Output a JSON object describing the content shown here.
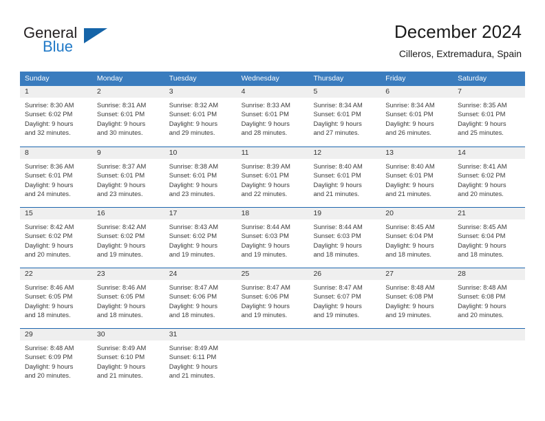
{
  "logo": {
    "word_top": "General",
    "word_bottom": "Blue",
    "triangle_color": "#1564a8",
    "blue_color": "#2079c7"
  },
  "header": {
    "title": "December 2024",
    "subtitle": "Cilleros, Extremadura, Spain"
  },
  "calendar": {
    "header_bg": "#3a7cbe",
    "row_border_color": "#1b64ad",
    "day_strip_bg": "#efefef",
    "weekdays": [
      "Sunday",
      "Monday",
      "Tuesday",
      "Wednesday",
      "Thursday",
      "Friday",
      "Saturday"
    ],
    "weeks": [
      [
        {
          "day": "1",
          "sunrise": "Sunrise: 8:30 AM",
          "sunset": "Sunset: 6:02 PM",
          "daylight_1": "Daylight: 9 hours",
          "daylight_2": "and 32 minutes."
        },
        {
          "day": "2",
          "sunrise": "Sunrise: 8:31 AM",
          "sunset": "Sunset: 6:01 PM",
          "daylight_1": "Daylight: 9 hours",
          "daylight_2": "and 30 minutes."
        },
        {
          "day": "3",
          "sunrise": "Sunrise: 8:32 AM",
          "sunset": "Sunset: 6:01 PM",
          "daylight_1": "Daylight: 9 hours",
          "daylight_2": "and 29 minutes."
        },
        {
          "day": "4",
          "sunrise": "Sunrise: 8:33 AM",
          "sunset": "Sunset: 6:01 PM",
          "daylight_1": "Daylight: 9 hours",
          "daylight_2": "and 28 minutes."
        },
        {
          "day": "5",
          "sunrise": "Sunrise: 8:34 AM",
          "sunset": "Sunset: 6:01 PM",
          "daylight_1": "Daylight: 9 hours",
          "daylight_2": "and 27 minutes."
        },
        {
          "day": "6",
          "sunrise": "Sunrise: 8:34 AM",
          "sunset": "Sunset: 6:01 PM",
          "daylight_1": "Daylight: 9 hours",
          "daylight_2": "and 26 minutes."
        },
        {
          "day": "7",
          "sunrise": "Sunrise: 8:35 AM",
          "sunset": "Sunset: 6:01 PM",
          "daylight_1": "Daylight: 9 hours",
          "daylight_2": "and 25 minutes."
        }
      ],
      [
        {
          "day": "8",
          "sunrise": "Sunrise: 8:36 AM",
          "sunset": "Sunset: 6:01 PM",
          "daylight_1": "Daylight: 9 hours",
          "daylight_2": "and 24 minutes."
        },
        {
          "day": "9",
          "sunrise": "Sunrise: 8:37 AM",
          "sunset": "Sunset: 6:01 PM",
          "daylight_1": "Daylight: 9 hours",
          "daylight_2": "and 23 minutes."
        },
        {
          "day": "10",
          "sunrise": "Sunrise: 8:38 AM",
          "sunset": "Sunset: 6:01 PM",
          "daylight_1": "Daylight: 9 hours",
          "daylight_2": "and 23 minutes."
        },
        {
          "day": "11",
          "sunrise": "Sunrise: 8:39 AM",
          "sunset": "Sunset: 6:01 PM",
          "daylight_1": "Daylight: 9 hours",
          "daylight_2": "and 22 minutes."
        },
        {
          "day": "12",
          "sunrise": "Sunrise: 8:40 AM",
          "sunset": "Sunset: 6:01 PM",
          "daylight_1": "Daylight: 9 hours",
          "daylight_2": "and 21 minutes."
        },
        {
          "day": "13",
          "sunrise": "Sunrise: 8:40 AM",
          "sunset": "Sunset: 6:01 PM",
          "daylight_1": "Daylight: 9 hours",
          "daylight_2": "and 21 minutes."
        },
        {
          "day": "14",
          "sunrise": "Sunrise: 8:41 AM",
          "sunset": "Sunset: 6:02 PM",
          "daylight_1": "Daylight: 9 hours",
          "daylight_2": "and 20 minutes."
        }
      ],
      [
        {
          "day": "15",
          "sunrise": "Sunrise: 8:42 AM",
          "sunset": "Sunset: 6:02 PM",
          "daylight_1": "Daylight: 9 hours",
          "daylight_2": "and 20 minutes."
        },
        {
          "day": "16",
          "sunrise": "Sunrise: 8:42 AM",
          "sunset": "Sunset: 6:02 PM",
          "daylight_1": "Daylight: 9 hours",
          "daylight_2": "and 19 minutes."
        },
        {
          "day": "17",
          "sunrise": "Sunrise: 8:43 AM",
          "sunset": "Sunset: 6:02 PM",
          "daylight_1": "Daylight: 9 hours",
          "daylight_2": "and 19 minutes."
        },
        {
          "day": "18",
          "sunrise": "Sunrise: 8:44 AM",
          "sunset": "Sunset: 6:03 PM",
          "daylight_1": "Daylight: 9 hours",
          "daylight_2": "and 19 minutes."
        },
        {
          "day": "19",
          "sunrise": "Sunrise: 8:44 AM",
          "sunset": "Sunset: 6:03 PM",
          "daylight_1": "Daylight: 9 hours",
          "daylight_2": "and 18 minutes."
        },
        {
          "day": "20",
          "sunrise": "Sunrise: 8:45 AM",
          "sunset": "Sunset: 6:04 PM",
          "daylight_1": "Daylight: 9 hours",
          "daylight_2": "and 18 minutes."
        },
        {
          "day": "21",
          "sunrise": "Sunrise: 8:45 AM",
          "sunset": "Sunset: 6:04 PM",
          "daylight_1": "Daylight: 9 hours",
          "daylight_2": "and 18 minutes."
        }
      ],
      [
        {
          "day": "22",
          "sunrise": "Sunrise: 8:46 AM",
          "sunset": "Sunset: 6:05 PM",
          "daylight_1": "Daylight: 9 hours",
          "daylight_2": "and 18 minutes."
        },
        {
          "day": "23",
          "sunrise": "Sunrise: 8:46 AM",
          "sunset": "Sunset: 6:05 PM",
          "daylight_1": "Daylight: 9 hours",
          "daylight_2": "and 18 minutes."
        },
        {
          "day": "24",
          "sunrise": "Sunrise: 8:47 AM",
          "sunset": "Sunset: 6:06 PM",
          "daylight_1": "Daylight: 9 hours",
          "daylight_2": "and 18 minutes."
        },
        {
          "day": "25",
          "sunrise": "Sunrise: 8:47 AM",
          "sunset": "Sunset: 6:06 PM",
          "daylight_1": "Daylight: 9 hours",
          "daylight_2": "and 19 minutes."
        },
        {
          "day": "26",
          "sunrise": "Sunrise: 8:47 AM",
          "sunset": "Sunset: 6:07 PM",
          "daylight_1": "Daylight: 9 hours",
          "daylight_2": "and 19 minutes."
        },
        {
          "day": "27",
          "sunrise": "Sunrise: 8:48 AM",
          "sunset": "Sunset: 6:08 PM",
          "daylight_1": "Daylight: 9 hours",
          "daylight_2": "and 19 minutes."
        },
        {
          "day": "28",
          "sunrise": "Sunrise: 8:48 AM",
          "sunset": "Sunset: 6:08 PM",
          "daylight_1": "Daylight: 9 hours",
          "daylight_2": "and 20 minutes."
        }
      ],
      [
        {
          "day": "29",
          "sunrise": "Sunrise: 8:48 AM",
          "sunset": "Sunset: 6:09 PM",
          "daylight_1": "Daylight: 9 hours",
          "daylight_2": "and 20 minutes."
        },
        {
          "day": "30",
          "sunrise": "Sunrise: 8:49 AM",
          "sunset": "Sunset: 6:10 PM",
          "daylight_1": "Daylight: 9 hours",
          "daylight_2": "and 21 minutes."
        },
        {
          "day": "31",
          "sunrise": "Sunrise: 8:49 AM",
          "sunset": "Sunset: 6:11 PM",
          "daylight_1": "Daylight: 9 hours",
          "daylight_2": "and 21 minutes."
        },
        {
          "day": "",
          "sunrise": "",
          "sunset": "",
          "daylight_1": "",
          "daylight_2": ""
        },
        {
          "day": "",
          "sunrise": "",
          "sunset": "",
          "daylight_1": "",
          "daylight_2": ""
        },
        {
          "day": "",
          "sunrise": "",
          "sunset": "",
          "daylight_1": "",
          "daylight_2": ""
        },
        {
          "day": "",
          "sunrise": "",
          "sunset": "",
          "daylight_1": "",
          "daylight_2": ""
        }
      ]
    ]
  }
}
